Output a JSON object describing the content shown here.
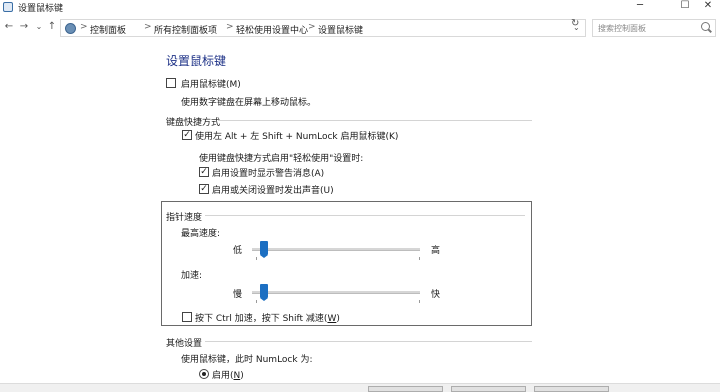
{
  "window": {
    "title": "设置鼠标键",
    "minimize": "─",
    "maximize": "☐",
    "close": "✕"
  },
  "nav": {
    "back": "←",
    "forward": "→",
    "recent": "⌄",
    "up": "↑",
    "breadcrumbs": [
      "控制面板",
      "所有控制面板项",
      "轻松使用设置中心",
      "设置鼠标键"
    ],
    "separator": ">",
    "dropdown": "⌄",
    "refresh": "↻",
    "search_placeholder": "搜索控制面板"
  },
  "page": {
    "heading": "设置鼠标键",
    "enable_mousekeys": {
      "label": "启用鼠标键(M)",
      "checked": false
    },
    "enable_desc": "使用数字键盘在屏幕上移动鼠标。",
    "shortcut_group": {
      "title": "键盘快捷方式",
      "use_shortcut": {
        "label": "使用左 Alt + 左 Shift + NumLock 启用鼠标键(K)",
        "checked": true
      },
      "when_desc": "使用键盘快捷方式启用\"轻松使用\"设置时:",
      "show_warning": {
        "label": "启用设置时显示警告消息(A)",
        "checked": true
      },
      "make_sound": {
        "label": "启用或关闭设置时发出声音(U)",
        "checked": true
      }
    },
    "pointer_speed": {
      "title": "指针速度",
      "top_speed_label": "最高速度:",
      "top_speed_low": "低",
      "top_speed_high": "高",
      "top_speed_value": 0.05,
      "acceleration_label": "加速:",
      "acceleration_low": "慢",
      "acceleration_high": "快",
      "acceleration_value": 0.05,
      "ctrl_shift": {
        "label_prefix": "按下 Ctrl 加速，按下 Shift 减速(",
        "label_key": "W",
        "label_suffix": ")",
        "checked": false
      }
    },
    "other_group": {
      "title": "其他设置",
      "numlock_desc": "使用鼠标键，此时 NumLock 为:",
      "on_option": {
        "label_prefix": "启用(",
        "label_key": "N",
        "label_suffix": ")",
        "selected": true
      }
    }
  },
  "colors": {
    "heading": "#1e3287",
    "slider_thumb": "#1c6fc2"
  }
}
